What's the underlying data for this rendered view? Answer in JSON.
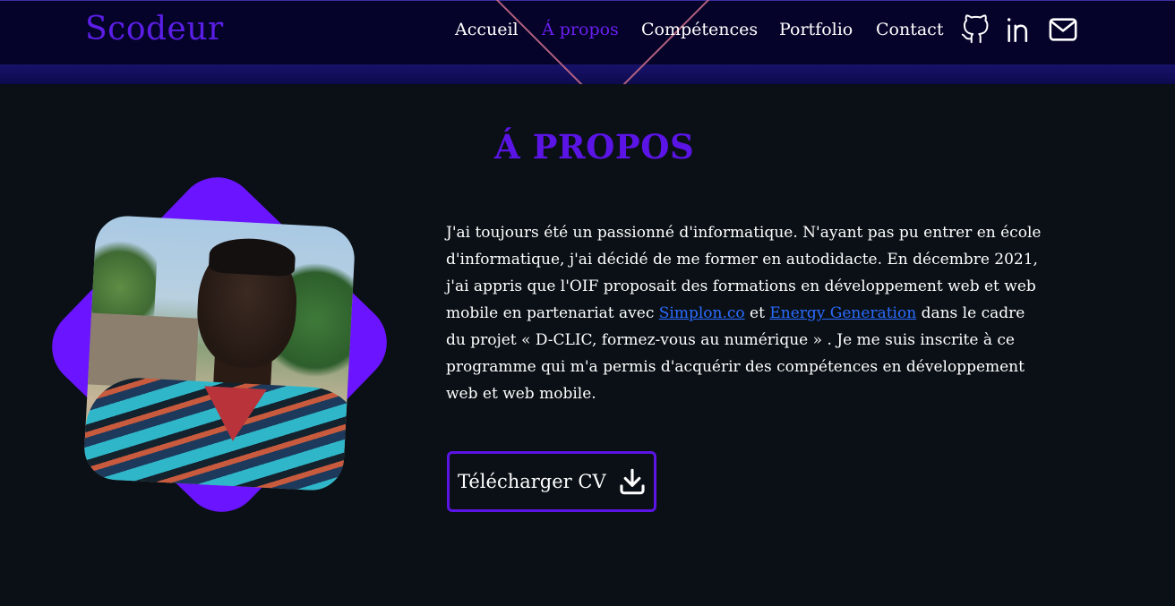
{
  "header": {
    "brand": "Scodeur",
    "nav": [
      {
        "label": "Accueil",
        "active": false
      },
      {
        "label": "Á propos",
        "active": true
      },
      {
        "label": "Compétences",
        "active": false
      },
      {
        "label": "Portfolio",
        "active": false
      },
      {
        "label": "Contact",
        "active": false
      }
    ],
    "icons": [
      "github-icon",
      "linkedin-icon",
      "mail-icon"
    ]
  },
  "about": {
    "title": "Á PROPOS",
    "text_1": "J'ai toujours été un passionné d'informatique. N'ayant pas pu entrer en école d'informatique, j'ai décidé de me former en autodidacte. En décembre 2021, j'ai appris que l'OIF proposait des formations en développement web et web mobile en partenariat avec ",
    "link_1": "Simplon.co",
    "text_2": " et ",
    "link_2": "Energy Generation",
    "text_3": " dans le cadre du projet « D-CLIC, formez-vous au numérique » . Je me suis inscrite à ce programme qui m'a permis d'acquérir des compétences en développement web et web mobile.",
    "cv_button": "Télécharger CV",
    "cv_icon": "download-icon"
  },
  "colors": {
    "accent": "#5b14e6",
    "background": "#0a1016",
    "header": "#05032a",
    "link": "#2b6cff"
  }
}
